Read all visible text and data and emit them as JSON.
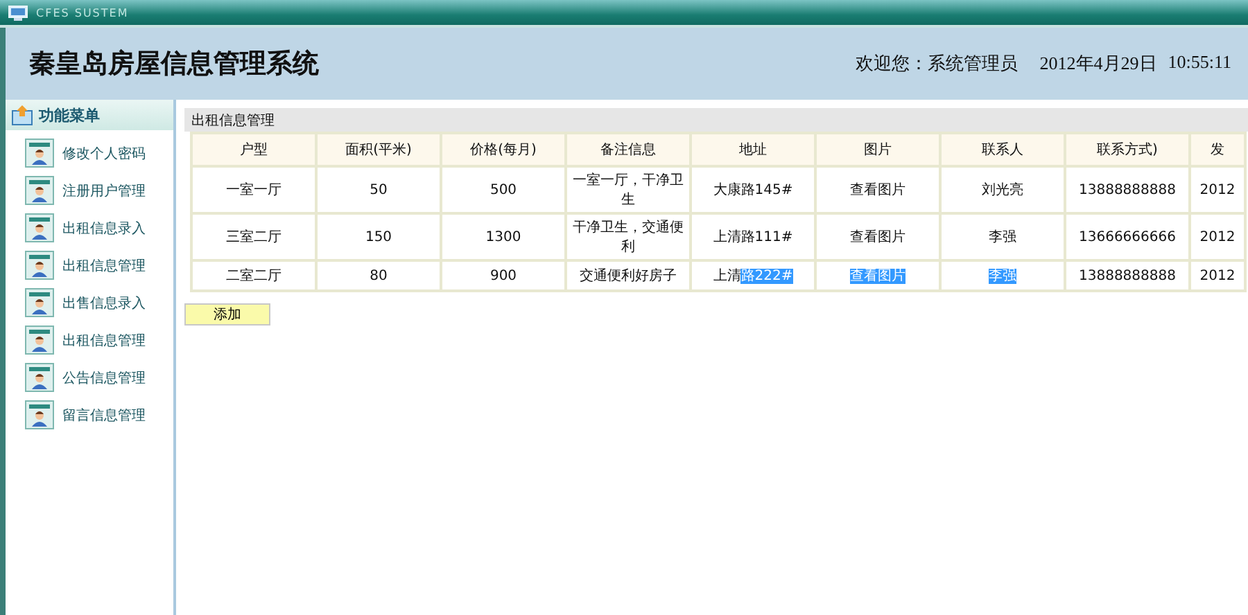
{
  "window": {
    "title": "CFES SUSTEM"
  },
  "header": {
    "title": "秦皇岛房屋信息管理系统",
    "welcome": "欢迎您：系统管理员",
    "date": "2012年4月29日",
    "time": "10:55:11"
  },
  "sidebar": {
    "title": "功能菜单",
    "items": [
      {
        "label": "修改个人密码"
      },
      {
        "label": "注册用户管理"
      },
      {
        "label": "出租信息录入"
      },
      {
        "label": "出租信息管理"
      },
      {
        "label": "出售信息录入"
      },
      {
        "label": "出租信息管理"
      },
      {
        "label": "公告信息管理"
      },
      {
        "label": "留言信息管理"
      }
    ]
  },
  "panel": {
    "title": "出租信息管理"
  },
  "table": {
    "columns": [
      "户型",
      "面积(平米)",
      "价格(每月)",
      "备注信息",
      "地址",
      "图片",
      "联系人",
      "联系方式)",
      "发"
    ],
    "rows": [
      {
        "cells": [
          {
            "text": "一室一厅",
            "highlighted": false
          },
          {
            "text": "50",
            "highlighted": false
          },
          {
            "text": "500",
            "highlighted": false
          },
          {
            "text": "一室一厅，干净卫生",
            "highlighted": false
          },
          {
            "text": "大康路145#",
            "highlighted": false
          },
          {
            "text": "查看图片",
            "highlighted": false
          },
          {
            "text": "刘光亮",
            "highlighted": false
          },
          {
            "text": "13888888888",
            "highlighted": false
          },
          {
            "text": "2012",
            "highlighted": false
          }
        ]
      },
      {
        "cells": [
          {
            "text": "三室二厅",
            "highlighted": false
          },
          {
            "text": "150",
            "highlighted": false
          },
          {
            "text": "1300",
            "highlighted": false
          },
          {
            "text": "干净卫生，交通便利",
            "highlighted": false
          },
          {
            "text": "上清路111#",
            "highlighted": false
          },
          {
            "text": "查看图片",
            "highlighted": false
          },
          {
            "text": "李强",
            "highlighted": false
          },
          {
            "text": "13666666666",
            "highlighted": false
          },
          {
            "text": "2012",
            "highlighted": false
          }
        ]
      },
      {
        "cells": [
          {
            "text": "二室二厅",
            "highlighted": false
          },
          {
            "text": "80",
            "highlighted": false
          },
          {
            "text": "900",
            "highlighted": false
          },
          {
            "text": "交通便利好房子",
            "highlighted": false
          },
          {
            "segments": [
              {
                "text": "上清",
                "highlighted": false
              },
              {
                "text": "路222#",
                "highlighted": true
              }
            ]
          },
          {
            "text": "查看图片",
            "highlighted": true
          },
          {
            "text": "李强",
            "highlighted": true
          },
          {
            "text": "13888888888",
            "highlighted": false
          },
          {
            "text": "2012",
            "highlighted": false
          }
        ]
      }
    ]
  },
  "add_button": {
    "label": "添加"
  }
}
